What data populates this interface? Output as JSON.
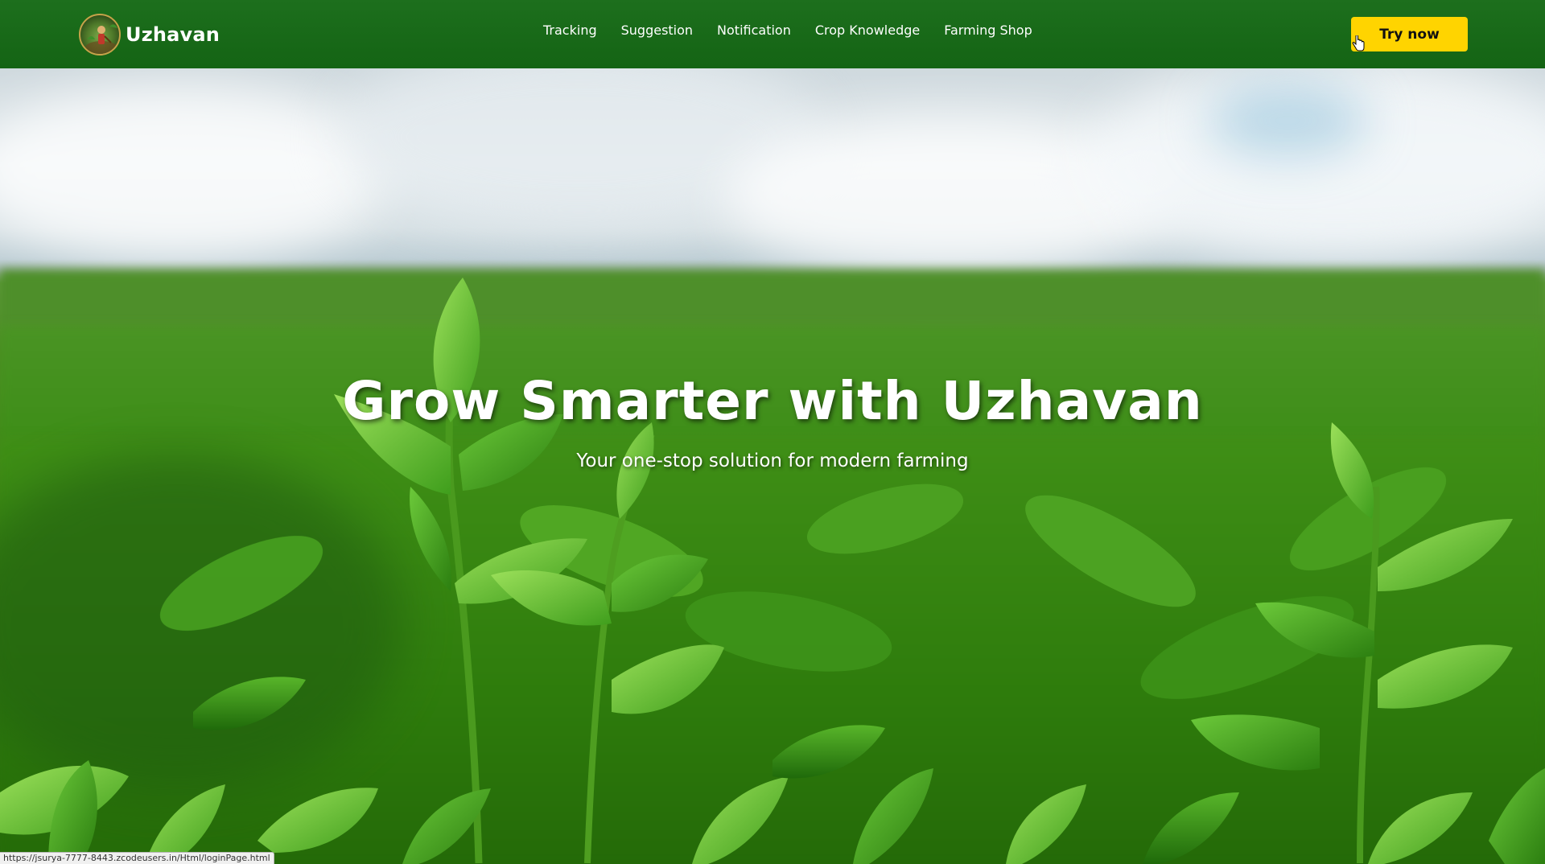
{
  "navbar": {
    "brand_name": "Uzhavan",
    "logo_icon": "farmer-logo-icon",
    "links": [
      {
        "label": "Tracking"
      },
      {
        "label": "Suggestion"
      },
      {
        "label": "Notification"
      },
      {
        "label": "Crop Knowledge"
      },
      {
        "label": "Farming Shop"
      }
    ],
    "cta_label": "Try now"
  },
  "hero": {
    "title": "Grow Smarter with Uzhavan",
    "subtitle": "Your one-stop solution for modern farming",
    "background": "tea-plantation-field-image"
  },
  "status_bar": {
    "url": "https://jsurya-7777-8443.zcodeusers.in/Html/loginPage.html"
  },
  "colors": {
    "navbar_bg": "#146414",
    "cta_bg": "#ffd400",
    "cta_text": "#111111",
    "text_light": "#ffffff"
  }
}
